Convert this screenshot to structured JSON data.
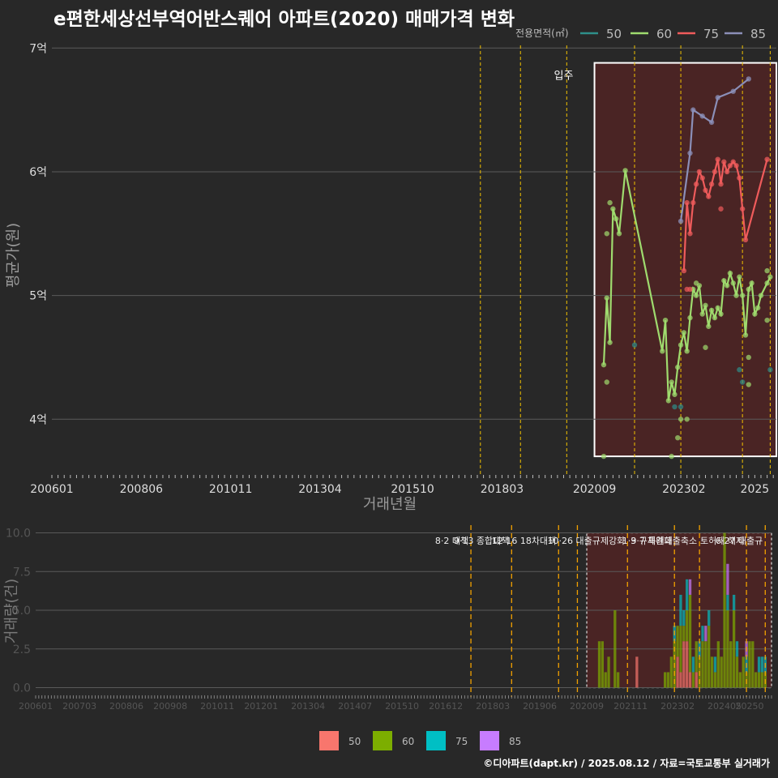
{
  "title": "e편한세상선부역어반스퀘어 아파트(2020) 매매가격 변화",
  "footer": "©디아파트(dapt.kr) / 2025.08.12 / 자료=국토교통부 실거래가",
  "colors": {
    "background": "#282828",
    "grid": "#5a5a5a",
    "s50": "#2e8f8a",
    "s60": "#9fdb6e",
    "s75": "#ef5b5b",
    "s85": "#8b8fb8",
    "bar50": "#f8766d",
    "bar60": "#7cae00",
    "bar75": "#00bfc4",
    "bar85": "#c77cff",
    "policy": "#f2c200",
    "highlight_fill": "#4a2424"
  },
  "chart_data": [
    {
      "type": "line",
      "title": "e편한세상선부역어반스퀘어 아파트(2020) 매매가격 변화",
      "xlabel": "거래년월",
      "ylabel": "평균가(원)",
      "x_range": [
        "2006-01",
        "2025-08"
      ],
      "ylim": [
        3.55,
        7.1
      ],
      "y_ticks": [
        4,
        5,
        6,
        7
      ],
      "y_tick_labels": [
        "4억",
        "5억",
        "6억",
        "7억"
      ],
      "x_tick_labels": [
        "200601",
        "200806",
        "201011",
        "201304",
        "201510",
        "201803",
        "202009",
        "202302",
        "2025"
      ],
      "legend_title": "전용면적(㎡)",
      "legend": [
        "50",
        "60",
        "75",
        "85"
      ],
      "legend_position": "top-right",
      "annotation": "입주",
      "annotation_x": "2019-11",
      "policy_dates": [
        "2017-08",
        "2018-09",
        "2019-12",
        "2021-10",
        "2023-01",
        "2024-09",
        "2025-06"
      ],
      "highlight_range": [
        "2020-09",
        "2025-08"
      ],
      "series": [
        {
          "name": "50",
          "points": [
            [
              "2021-10",
              4.6
            ],
            [
              "2022-11",
              4.1
            ],
            [
              "2023-01",
              4.1
            ],
            [
              "2024-08",
              4.4
            ],
            [
              "2024-09",
              4.3
            ],
            [
              "2025-06",
              4.4
            ]
          ]
        },
        {
          "name": "60",
          "line": [
            [
              "2020-12",
              4.44
            ],
            [
              "2021-01",
              4.98
            ],
            [
              "2021-02",
              4.62
            ],
            [
              "2021-03",
              5.7
            ],
            [
              "2021-04",
              5.62
            ],
            [
              "2021-05",
              5.5
            ],
            [
              "2021-07",
              6.01
            ],
            [
              "2022-07",
              4.55
            ],
            [
              "2022-08",
              4.8
            ],
            [
              "2022-09",
              4.15
            ],
            [
              "2022-10",
              4.3
            ],
            [
              "2022-11",
              4.2
            ],
            [
              "2022-12",
              4.42
            ],
            [
              "2023-01",
              4.6
            ],
            [
              "2023-02",
              4.7
            ],
            [
              "2023-03",
              4.55
            ],
            [
              "2023-04",
              4.82
            ],
            [
              "2023-05",
              5.05
            ],
            [
              "2023-06",
              5.0
            ],
            [
              "2023-07",
              5.08
            ],
            [
              "2023-08",
              4.85
            ],
            [
              "2023-09",
              4.92
            ],
            [
              "2023-10",
              4.75
            ],
            [
              "2023-11",
              4.88
            ],
            [
              "2023-12",
              4.82
            ],
            [
              "2024-01",
              4.9
            ],
            [
              "2024-02",
              4.85
            ],
            [
              "2024-03",
              5.12
            ],
            [
              "2024-04",
              5.08
            ],
            [
              "2024-05",
              5.18
            ],
            [
              "2024-06",
              5.1
            ],
            [
              "2024-07",
              5.0
            ],
            [
              "2024-08",
              5.15
            ],
            [
              "2024-09",
              5.0
            ],
            [
              "2024-10",
              4.68
            ],
            [
              "2024-11",
              5.05
            ],
            [
              "2024-12",
              5.1
            ],
            [
              "2025-01",
              4.85
            ],
            [
              "2025-02",
              4.9
            ],
            [
              "2025-03",
              5.0
            ],
            [
              "2025-05",
              5.1
            ],
            [
              "2025-06",
              5.15
            ]
          ]
        },
        {
          "name": "60 scatter",
          "points": [
            [
              "2020-12",
              3.7
            ],
            [
              "2021-01",
              4.3
            ],
            [
              "2021-01",
              5.5
            ],
            [
              "2021-02",
              5.75
            ],
            [
              "2022-10",
              3.7
            ],
            [
              "2022-12",
              3.85
            ],
            [
              "2023-01",
              4.0
            ],
            [
              "2023-03",
              4.0
            ],
            [
              "2023-06",
              5.1
            ],
            [
              "2023-09",
              4.58
            ],
            [
              "2024-11",
              4.28
            ],
            [
              "2024-11",
              4.5
            ],
            [
              "2025-05",
              5.2
            ],
            [
              "2025-05",
              4.8
            ]
          ]
        },
        {
          "name": "75",
          "line": [
            [
              "2023-02",
              5.2
            ],
            [
              "2023-03",
              5.75
            ],
            [
              "2023-04",
              5.5
            ],
            [
              "2023-05",
              5.75
            ],
            [
              "2023-06",
              5.9
            ],
            [
              "2023-07",
              6.0
            ],
            [
              "2023-08",
              5.95
            ],
            [
              "2023-09",
              5.85
            ],
            [
              "2023-10",
              5.8
            ],
            [
              "2023-11",
              5.9
            ],
            [
              "2023-12",
              6.0
            ],
            [
              "2024-01",
              6.1
            ],
            [
              "2024-02",
              5.9
            ],
            [
              "2024-03",
              6.08
            ],
            [
              "2024-04",
              6.0
            ],
            [
              "2024-05",
              6.05
            ],
            [
              "2024-06",
              6.08
            ],
            [
              "2024-07",
              6.05
            ],
            [
              "2024-08",
              5.95
            ],
            [
              "2024-09",
              5.7
            ],
            [
              "2024-10",
              5.45
            ],
            [
              "2025-05",
              6.1
            ]
          ]
        },
        {
          "name": "75 scatter",
          "points": [
            [
              "2023-03",
              5.05
            ],
            [
              "2023-04",
              5.05
            ],
            [
              "2024-02",
              5.7
            ]
          ]
        },
        {
          "name": "85",
          "line": [
            [
              "2023-01",
              5.6
            ],
            [
              "2023-04",
              6.15
            ],
            [
              "2023-05",
              6.5
            ],
            [
              "2023-08",
              6.45
            ],
            [
              "2023-11",
              6.4
            ],
            [
              "2024-01",
              6.6
            ],
            [
              "2024-06",
              6.65
            ],
            [
              "2024-11",
              6.75
            ]
          ]
        }
      ]
    },
    {
      "type": "bar",
      "ylabel": "거래량(건)",
      "ylim": [
        -0.6,
        10.5
      ],
      "y_ticks": [
        0,
        2.5,
        5,
        7.5,
        10
      ],
      "y_tick_labels": [
        "0.0",
        "2.5",
        "5.0",
        "7.5",
        "10.0"
      ],
      "x_tick_labels": [
        "200601",
        "200703",
        "200806",
        "200908",
        "201011",
        "201201",
        "201304",
        "201407",
        "201510",
        "201612",
        "201803",
        "201906",
        "202009",
        "202111",
        "202302",
        "202405",
        "20250"
      ],
      "legend": [
        "50",
        "60",
        "75",
        "85"
      ],
      "legend_position": "bottom",
      "highlight_range": [
        "2020-09",
        "2025-08"
      ],
      "policy_lines": [
        {
          "date": "2017-08",
          "label": "8·2 대책"
        },
        {
          "date": "2018-09",
          "label": "9·13 종합대책"
        },
        {
          "date": "2019-12",
          "label": "12·16 18차대책"
        },
        {
          "date": "2020-06",
          "label": ""
        },
        {
          "date": "2021-10",
          "label": "10·26 대출규제강화"
        },
        {
          "date": "2023-01",
          "label": "1·3 규제완화"
        },
        {
          "date": "2023-09",
          "label": "9·7 특례대출축소"
        },
        {
          "date": "2024-12",
          "label": "토허제 해제"
        },
        {
          "date": "2025-06",
          "label": "6·27 대출규"
        }
      ],
      "stacks": [
        [
          "2021-01",
          0,
          3,
          0,
          0
        ],
        [
          "2021-02",
          0,
          3,
          0,
          0
        ],
        [
          "2021-03",
          0,
          1,
          0,
          0
        ],
        [
          "2021-04",
          0,
          2,
          0,
          0
        ],
        [
          "2021-06",
          0,
          5,
          0,
          0
        ],
        [
          "2021-07",
          0,
          1,
          0,
          0
        ],
        [
          "2022-01",
          2,
          0,
          0,
          0
        ],
        [
          "2022-10",
          0,
          1,
          0,
          0
        ],
        [
          "2022-11",
          0,
          1,
          0,
          0
        ],
        [
          "2022-12",
          0,
          2,
          0,
          0
        ],
        [
          "2023-01",
          0,
          3,
          1,
          0
        ],
        [
          "2023-02",
          2,
          2,
          0,
          0
        ],
        [
          "2023-03",
          1,
          3,
          2,
          0
        ],
        [
          "2023-04",
          3,
          1,
          1,
          0
        ],
        [
          "2023-05",
          3,
          2,
          2,
          0
        ],
        [
          "2023-06",
          1,
          5,
          0,
          1
        ],
        [
          "2023-07",
          0,
          1,
          1,
          0
        ],
        [
          "2023-08",
          1,
          2,
          0,
          0
        ],
        [
          "2023-09",
          0,
          2,
          1,
          0
        ],
        [
          "2023-10",
          0,
          3,
          1,
          0
        ],
        [
          "2023-11",
          0,
          3,
          0,
          1
        ],
        [
          "2023-12",
          0,
          4,
          1,
          0
        ],
        [
          "2024-01",
          0,
          2,
          0,
          0
        ],
        [
          "2024-02",
          0,
          1,
          1,
          0
        ],
        [
          "2024-03",
          0,
          3,
          0,
          0
        ],
        [
          "2024-04",
          0,
          2,
          0,
          0
        ],
        [
          "2024-05",
          0,
          10,
          0,
          0
        ],
        [
          "2024-06",
          0,
          5,
          1,
          2
        ],
        [
          "2024-07",
          0,
          3,
          0,
          0
        ],
        [
          "2024-08",
          0,
          5,
          1,
          0
        ],
        [
          "2024-09",
          0,
          2,
          1,
          0
        ],
        [
          "2024-10",
          0,
          1,
          0,
          0
        ],
        [
          "2024-11",
          0,
          2,
          0,
          0
        ],
        [
          "2024-12",
          0,
          1,
          1,
          1
        ],
        [
          "2025-01",
          0,
          3,
          0,
          0
        ],
        [
          "2025-02",
          0,
          3,
          0,
          0
        ],
        [
          "2025-03",
          0,
          1,
          0,
          0
        ],
        [
          "2025-04",
          0,
          1,
          1,
          0
        ],
        [
          "2025-05",
          0,
          1,
          1,
          0
        ],
        [
          "2025-06",
          0,
          1,
          1,
          0
        ]
      ]
    }
  ]
}
